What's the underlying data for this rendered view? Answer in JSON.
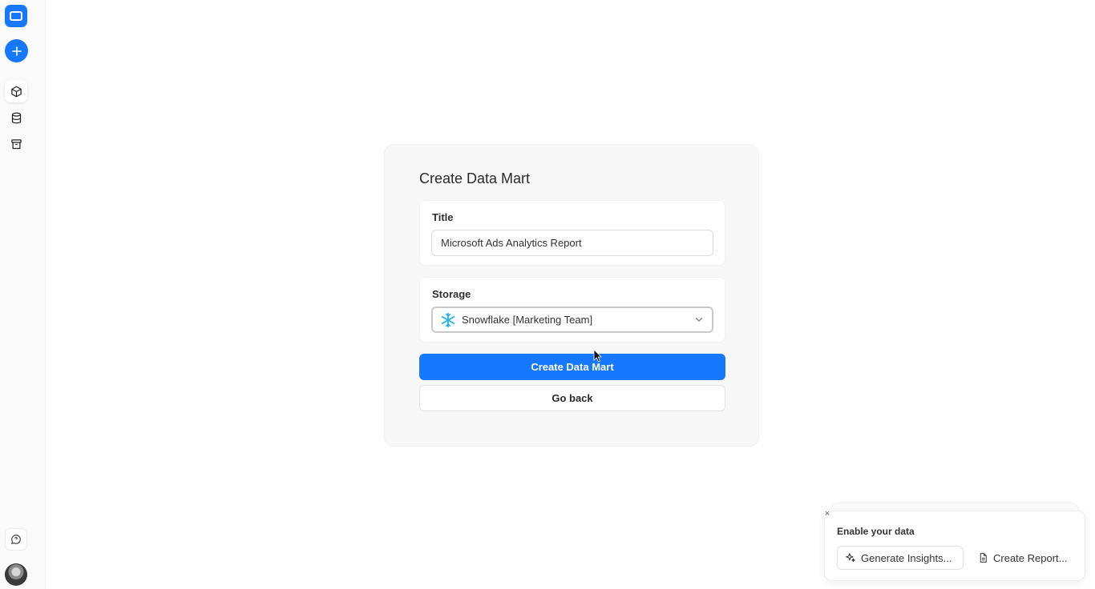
{
  "sidebar": {
    "items": [
      {
        "icon": "box-icon",
        "label": ""
      },
      {
        "icon": "database-icon",
        "label": ""
      },
      {
        "icon": "archive-icon",
        "label": ""
      }
    ],
    "accent_color": "#1677ff"
  },
  "form": {
    "heading": "Create Data Mart",
    "title_label": "Title",
    "title_value": "Microsoft Ads Analytics Report",
    "storage_label": "Storage",
    "storage_value": "Snowflake [Marketing Team]",
    "storage_icon": "snowflake-icon",
    "submit_label": "Create Data Mart",
    "back_label": "Go back"
  },
  "toast": {
    "close_glyph": "×",
    "title": "Enable your data",
    "insights_label": "Generate Insights...",
    "report_label": "Create Report..."
  }
}
